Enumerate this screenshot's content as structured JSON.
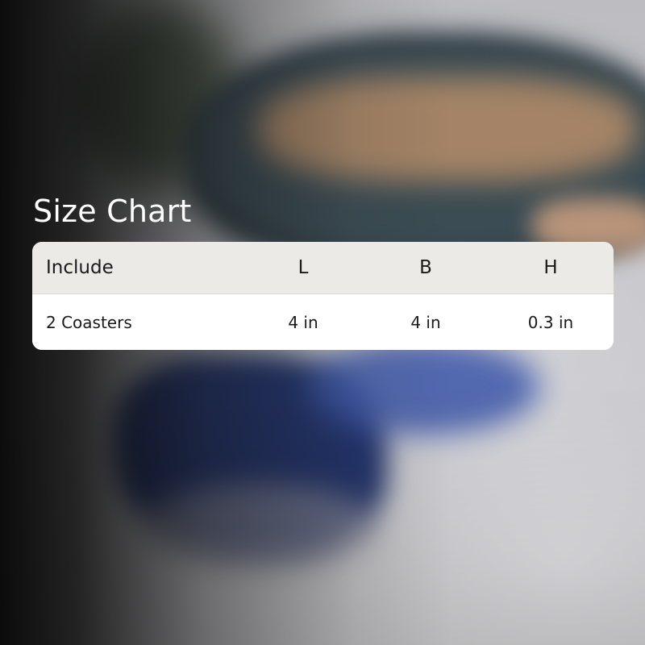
{
  "title": "Size Chart",
  "table": {
    "headers": [
      "Include",
      "L",
      "B",
      "H"
    ],
    "rows": [
      [
        "2 Coasters",
        "4 in",
        "4 in",
        "0.3 in"
      ]
    ]
  },
  "colors": {
    "title_text": "#ffffff",
    "header_bg": "#ebeae6",
    "body_bg": "#ffffff",
    "cell_text": "#1a1a1a"
  }
}
